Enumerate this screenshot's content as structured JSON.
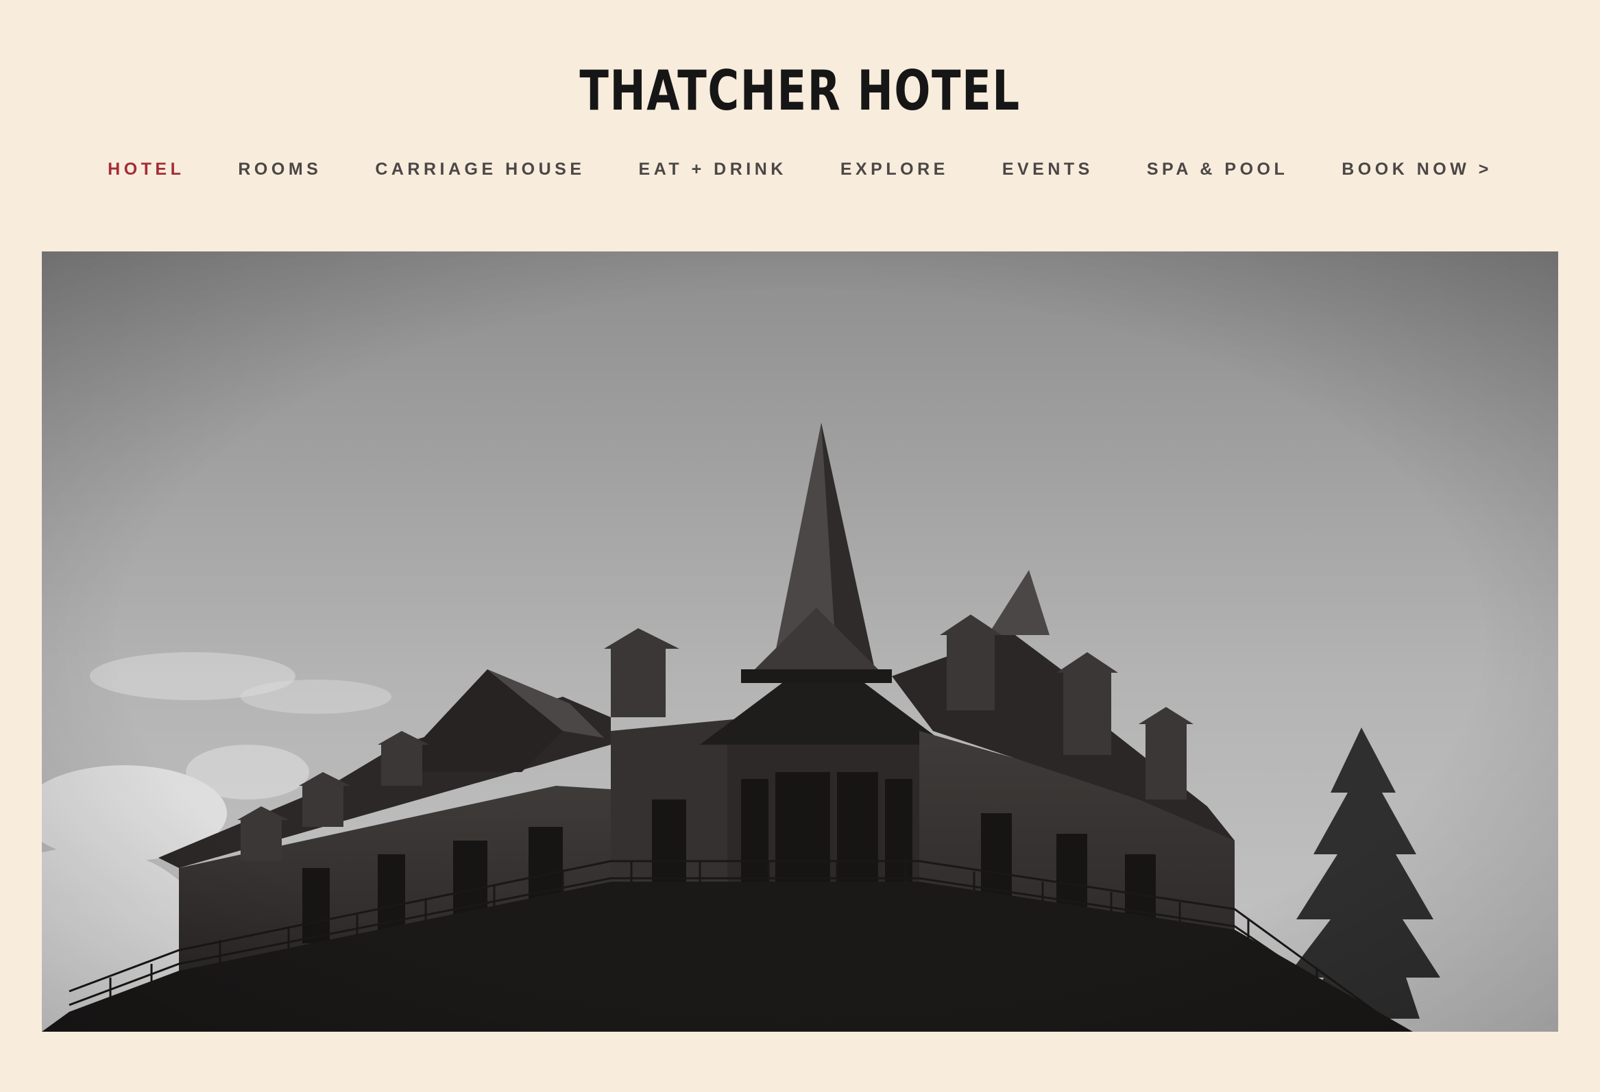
{
  "header": {
    "title": "THATCHER HOTEL"
  },
  "nav": {
    "items": [
      {
        "label": "HOTEL",
        "active": true
      },
      {
        "label": "ROOMS",
        "active": false
      },
      {
        "label": "CARRIAGE HOUSE",
        "active": false
      },
      {
        "label": "EAT + DRINK",
        "active": false
      },
      {
        "label": "EXPLORE",
        "active": false
      },
      {
        "label": "EVENTS",
        "active": false
      },
      {
        "label": "SPA & POOL",
        "active": false
      },
      {
        "label": "BOOK NOW >",
        "active": false
      }
    ]
  },
  "colors": {
    "background": "#f8ecdc",
    "accent": "#a52b34",
    "nav_text": "#4a4745",
    "title_text": "#161616"
  },
  "hero": {
    "icon": "hotel-photo"
  }
}
